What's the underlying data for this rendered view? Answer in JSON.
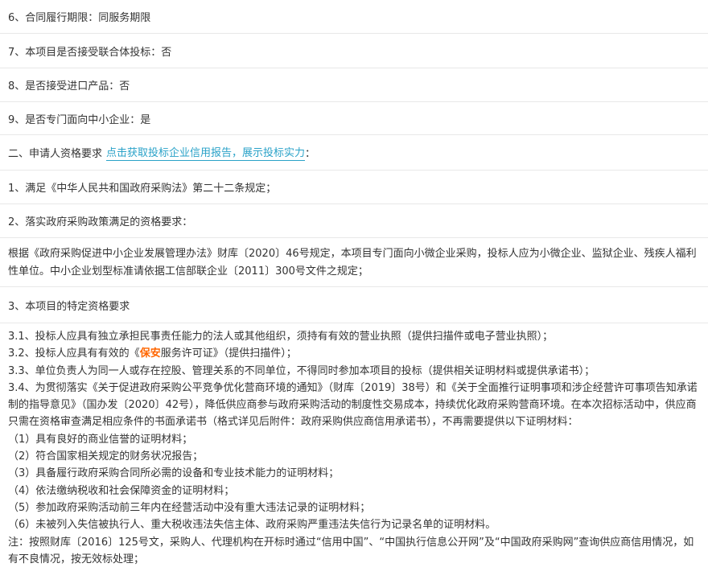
{
  "rows": {
    "r1": "6、合同履行期限：同服务期限",
    "r2": "7、本项目是否接受联合体投标：否",
    "r3": "8、是否接受进口产品：否",
    "r4": "9、是否专门面向中小企业：是",
    "r5_prefix": "二、申请人资格要求",
    "r5_link": "点击获取投标企业信用报告，展示投标实力",
    "r5_suffix": "：",
    "r6": "1、满足《中华人民共和国政府采购法》第二十二条规定；",
    "r7": "2、落实政府采购政策满足的资格要求：",
    "r8": "根据《政府采购促进中小企业发展管理办法》财库〔2020〕46号规定，本项目专门面向小微企业采购，投标人应为小微企业、监狱企业、残疾人福利性单位。中小企业划型标准请依据工信部联企业〔2011〕300号文件之规定；",
    "r9": "3、本项目的特定资格要求"
  },
  "requirements": {
    "l1": "3.1、投标人应具有独立承担民事责任能力的法人或其他组织，须持有有效的营业执照（提供扫描件或电子营业执照）；",
    "l2_a": "3.2、投标人应具有有效的《",
    "l2_hl": "保安",
    "l2_b": "服务许可证》（提供扫描件）；",
    "l3": "3.3、单位负责人为同一人或存在控股、管理关系的不同单位，不得同时参加本项目的投标（提供相关证明材料或提供承诺书）；",
    "l4": "3.4、为贯彻落实《关于促进政府采购公平竞争优化营商环境的通知》（财库〔2019〕38号）和《关于全面推行证明事项和涉企经营许可事项告知承诺制的指导意见》（国办发〔2020〕42号），降低供应商参与政府采购活动的制度性交易成本，持续优化政府采购营商环境。在本次招标活动中，供应商只需在资格审查满足相应条件的书面承诺书（格式详见后附件：政府采购供应商信用承诺书），不再需要提供以下证明材料：",
    "l5": "（1）具有良好的商业信誉的证明材料；",
    "l6": "（2）符合国家相关规定的财务状况报告；",
    "l7": "（3）具备履行政府采购合同所必需的设备和专业技术能力的证明材料；",
    "l8": "（4）依法缴纳税收和社会保障资金的证明材料；",
    "l9": "（5）参加政府采购活动前三年内在经营活动中没有重大违法记录的证明材料；",
    "l10": "（6）未被列入失信被执行人、重大税收违法失信主体、政府采购严重违法失信行为记录名单的证明材料。",
    "l11": "注：按照财库〔2016〕125号文，采购人、代理机构在开标时通过“信用中国”、“中国执行信息公开网”及“中国政府采购网”查询供应商信用情况，如有不良情况，按无效标处理；"
  },
  "colors": {
    "text": "#333333",
    "link": "#2aa2c8",
    "highlight": "#ff6600",
    "divider": "#e8e8e8"
  }
}
